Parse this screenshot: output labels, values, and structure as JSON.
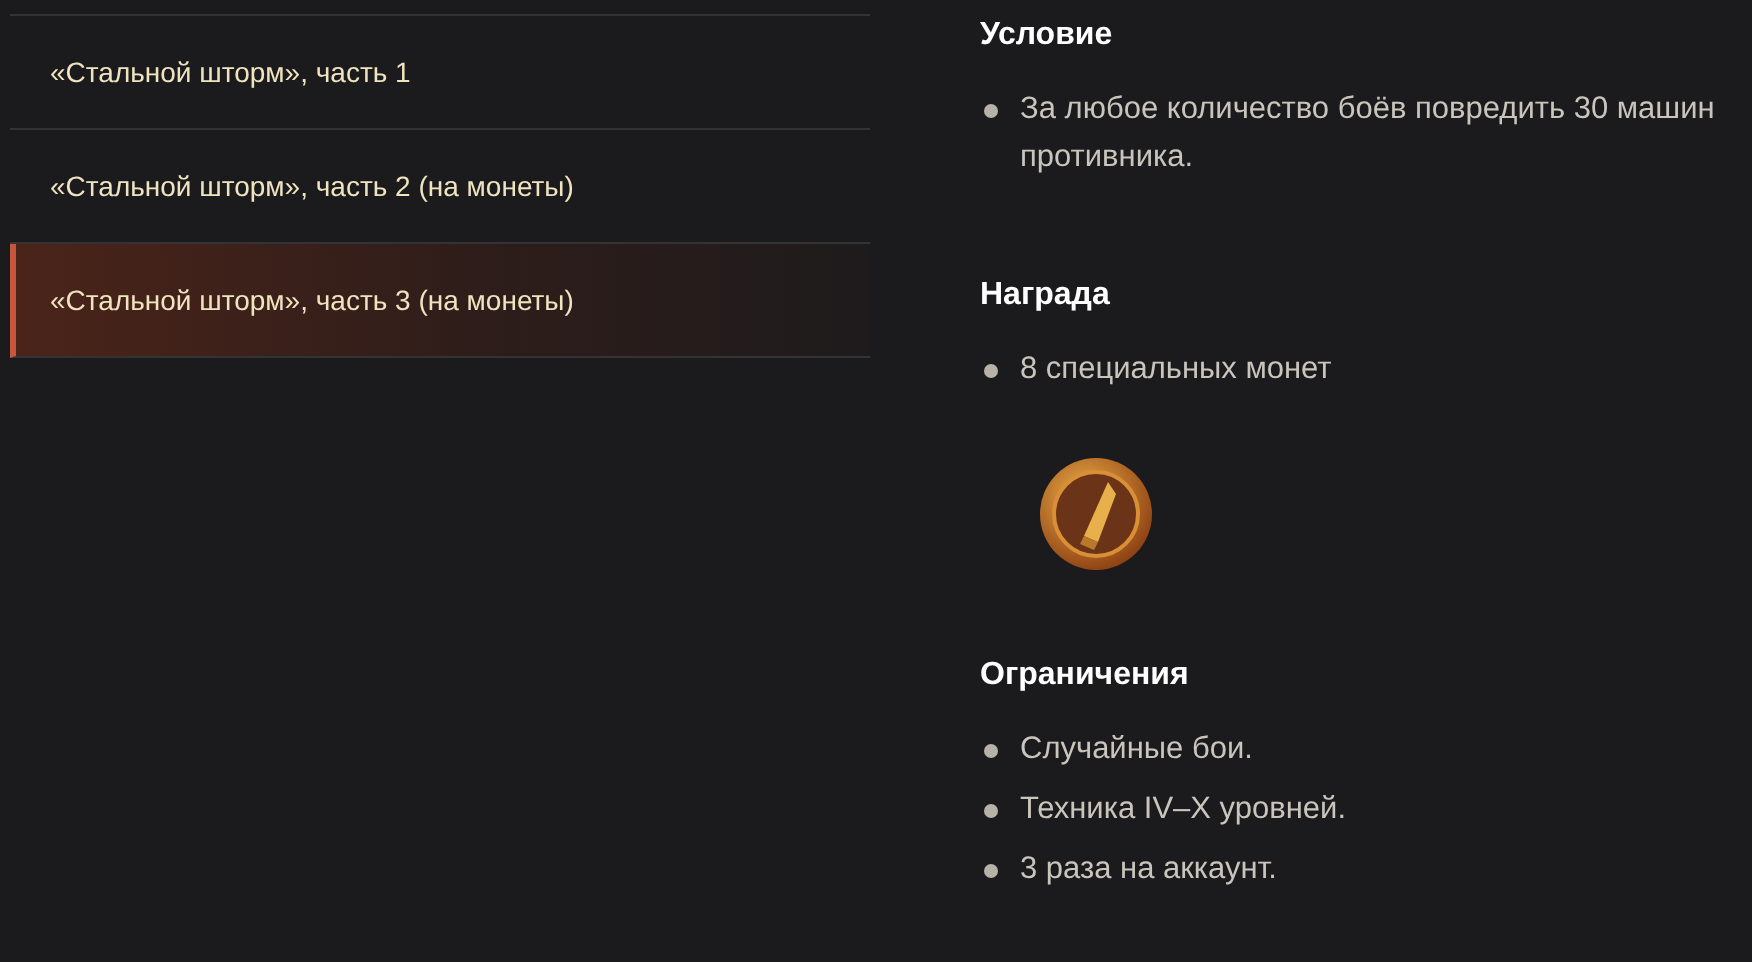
{
  "missions": [
    {
      "label": "«Стальной шторм», часть 1",
      "selected": false
    },
    {
      "label": "«Стальной шторм», часть 2 (на монеты)",
      "selected": false
    },
    {
      "label": "«Стальной шторм», часть 3 (на монеты)",
      "selected": true
    }
  ],
  "sections": [
    {
      "kind": "list",
      "title": "Условие",
      "items": [
        "За любое количество боёв повредить 30 машин противника."
      ]
    },
    {
      "kind": "reward",
      "title": "Награда",
      "items": [
        "8 специальных монет"
      ]
    },
    {
      "kind": "list",
      "title": "Ограничения",
      "items": [
        "Случайные бои.",
        "Техника IV–X уровней.",
        "3 раза на аккаунт."
      ]
    }
  ]
}
